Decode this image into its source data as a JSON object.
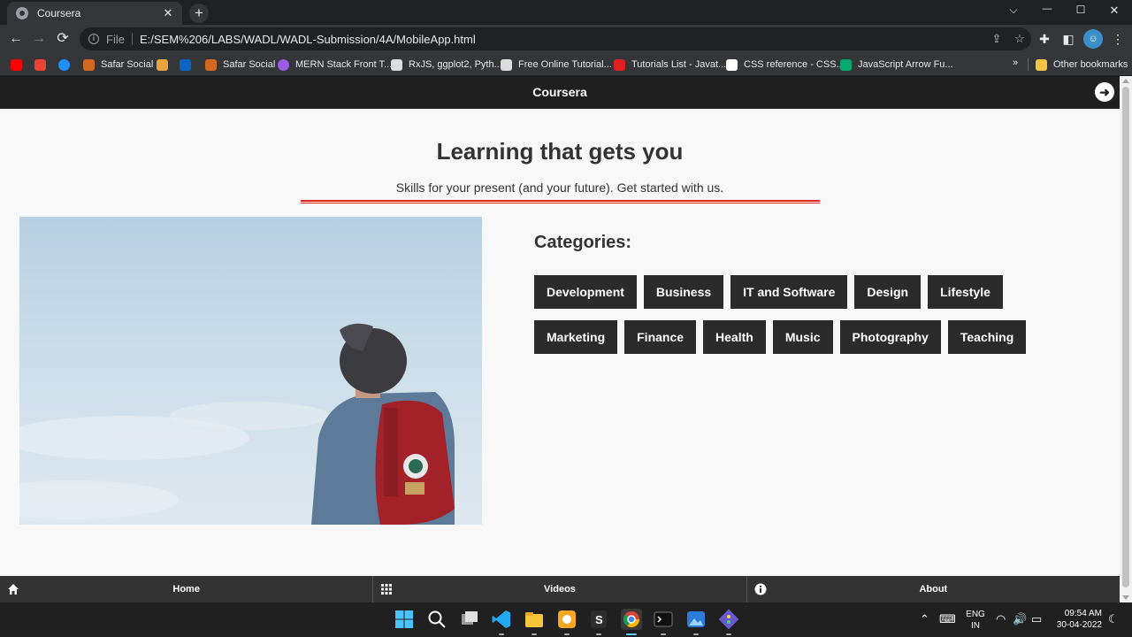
{
  "browser": {
    "tab_title": "Coursera",
    "new_tab_symbol": "+",
    "tab_close_symbol": "✕",
    "window_controls": {
      "dropdown": "⌵",
      "minimize": "—",
      "maximize": "☐",
      "close": "✕"
    },
    "url_scheme": "File",
    "url": "E:/SEM%206/LABS/WADL/WADL-Submission/4A/MobileApp.html",
    "bookmarks": [
      {
        "label": "",
        "icon": "youtube-icon",
        "color": "#ff0000"
      },
      {
        "label": "",
        "icon": "gmail-icon",
        "color": "#ea4335"
      },
      {
        "label": "",
        "icon": "edge-icon",
        "color": "#1e90ff"
      },
      {
        "label": "Safar Social",
        "icon": "safar-icon",
        "color": "#d2691e"
      },
      {
        "label": "",
        "icon": "bolt-icon",
        "color": "#e8a33d"
      },
      {
        "label": "",
        "icon": "linkedin-icon",
        "color": "#0a66c2"
      },
      {
        "label": "Safar Social",
        "icon": "safar-icon",
        "color": "#d2691e"
      },
      {
        "label": "MERN Stack Front T...",
        "icon": "mern-icon",
        "color": "#9b5de5"
      },
      {
        "label": "RxJS, ggplot2, Pyth...",
        "icon": "globe-icon",
        "color": "#dddddd"
      },
      {
        "label": "Free Online Tutorial...",
        "icon": "globe-icon",
        "color": "#dddddd"
      },
      {
        "label": "Tutorials List - Javat...",
        "icon": "javatpoint-icon",
        "color": "#e02020"
      },
      {
        "label": "CSS reference - CSS...",
        "icon": "mdn-icon",
        "color": "#ffffff"
      },
      {
        "label": "JavaScript Arrow Fu...",
        "icon": "w3-icon",
        "color": "#04aa6d"
      }
    ],
    "bookmarks_overflow": "»",
    "other_bookmarks": "Other bookmarks"
  },
  "page": {
    "header_title": "Coursera",
    "hero_title": "Learning that gets you",
    "hero_subtitle": "Skills for your present (and your future). Get started with us.",
    "categories_heading": "Categories:",
    "categories": [
      "Development",
      "Business",
      "IT and Software",
      "Design",
      "Lifestyle",
      "Marketing",
      "Finance",
      "Health",
      "Music",
      "Photography",
      "Teaching"
    ],
    "footer": {
      "home": "Home",
      "videos": "Videos",
      "about": "About"
    },
    "accent_color": "#dd2222",
    "button_color": "#2b2b2b"
  },
  "taskbar": {
    "language": "ENG",
    "region": "IN",
    "time": "09:54 AM",
    "date": "30-04-2022"
  }
}
